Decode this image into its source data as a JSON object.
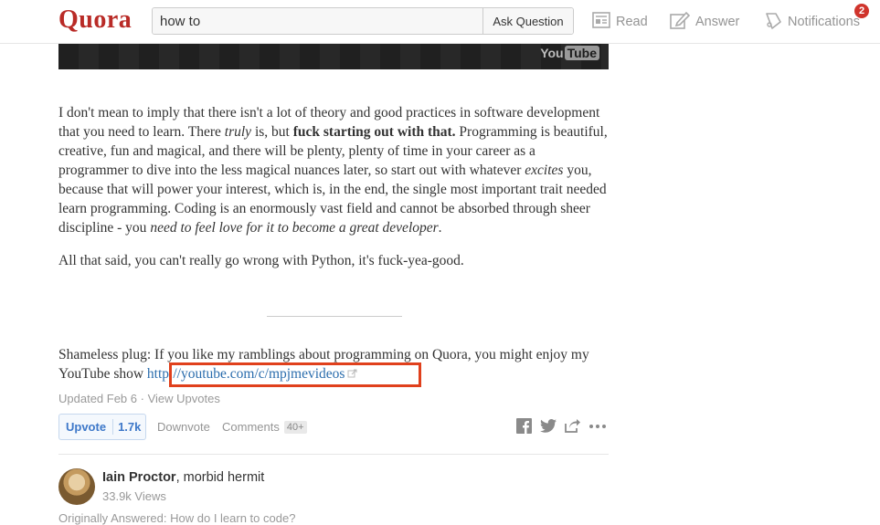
{
  "header": {
    "logo": "Quora",
    "search_value": "how to",
    "ask_button": "Ask Question",
    "nav": {
      "read": "Read",
      "answer": "Answer",
      "notifications": "Notifications"
    },
    "notification_count": "2"
  },
  "video": {
    "logo_you": "You",
    "logo_tube": "Tube"
  },
  "answer": {
    "p1": {
      "t1": "I don't mean to imply that there isn't a lot of theory and good practices in software development that you need to learn. There ",
      "em1": "truly",
      "t2": " is, but ",
      "bold": "fuck starting out with that.",
      "t3": " Programming is beautiful, creative, fun and magical, and there will be plenty, plenty of time in your career as a programmer to dive into the less magical nuances later, so start out with whatever ",
      "em2": "excites",
      "t4": " you, because that will power your interest, which is, in the end, the single most important trait needed learn programming. Coding is an enormously vast field and cannot be absorbed through sheer discipline - you ",
      "em3": "need to feel love for it to become a great developer",
      "t5": "."
    },
    "p2": "All that said, you can't really go wrong with Python, it's fuck-yea-good.",
    "plug_text": "Shameless plug: If you like my ramblings about programming on Quora, you might enjoy my YouTube show ",
    "plug_link": "http://youtube.com/c/mpjmevideos",
    "updated": "Updated Feb 6",
    "dot": " · ",
    "view_upvotes": "View Upvotes",
    "upvote_label": "Upvote",
    "upvote_count": "1.7k",
    "downvote_label": "Downvote",
    "comments_label": "Comments",
    "comments_count": "40+"
  },
  "next_answer": {
    "author_name": "Iain Proctor",
    "author_bio": ", morbid hermit",
    "views": "33.9k Views",
    "originally_label": "Originally Answered: ",
    "originally_question": "How do I learn to code?"
  },
  "colors": {
    "brand": "#b92b27",
    "link": "#2b6dad",
    "highlight": "#e0401c",
    "badge": "#d0342c"
  }
}
